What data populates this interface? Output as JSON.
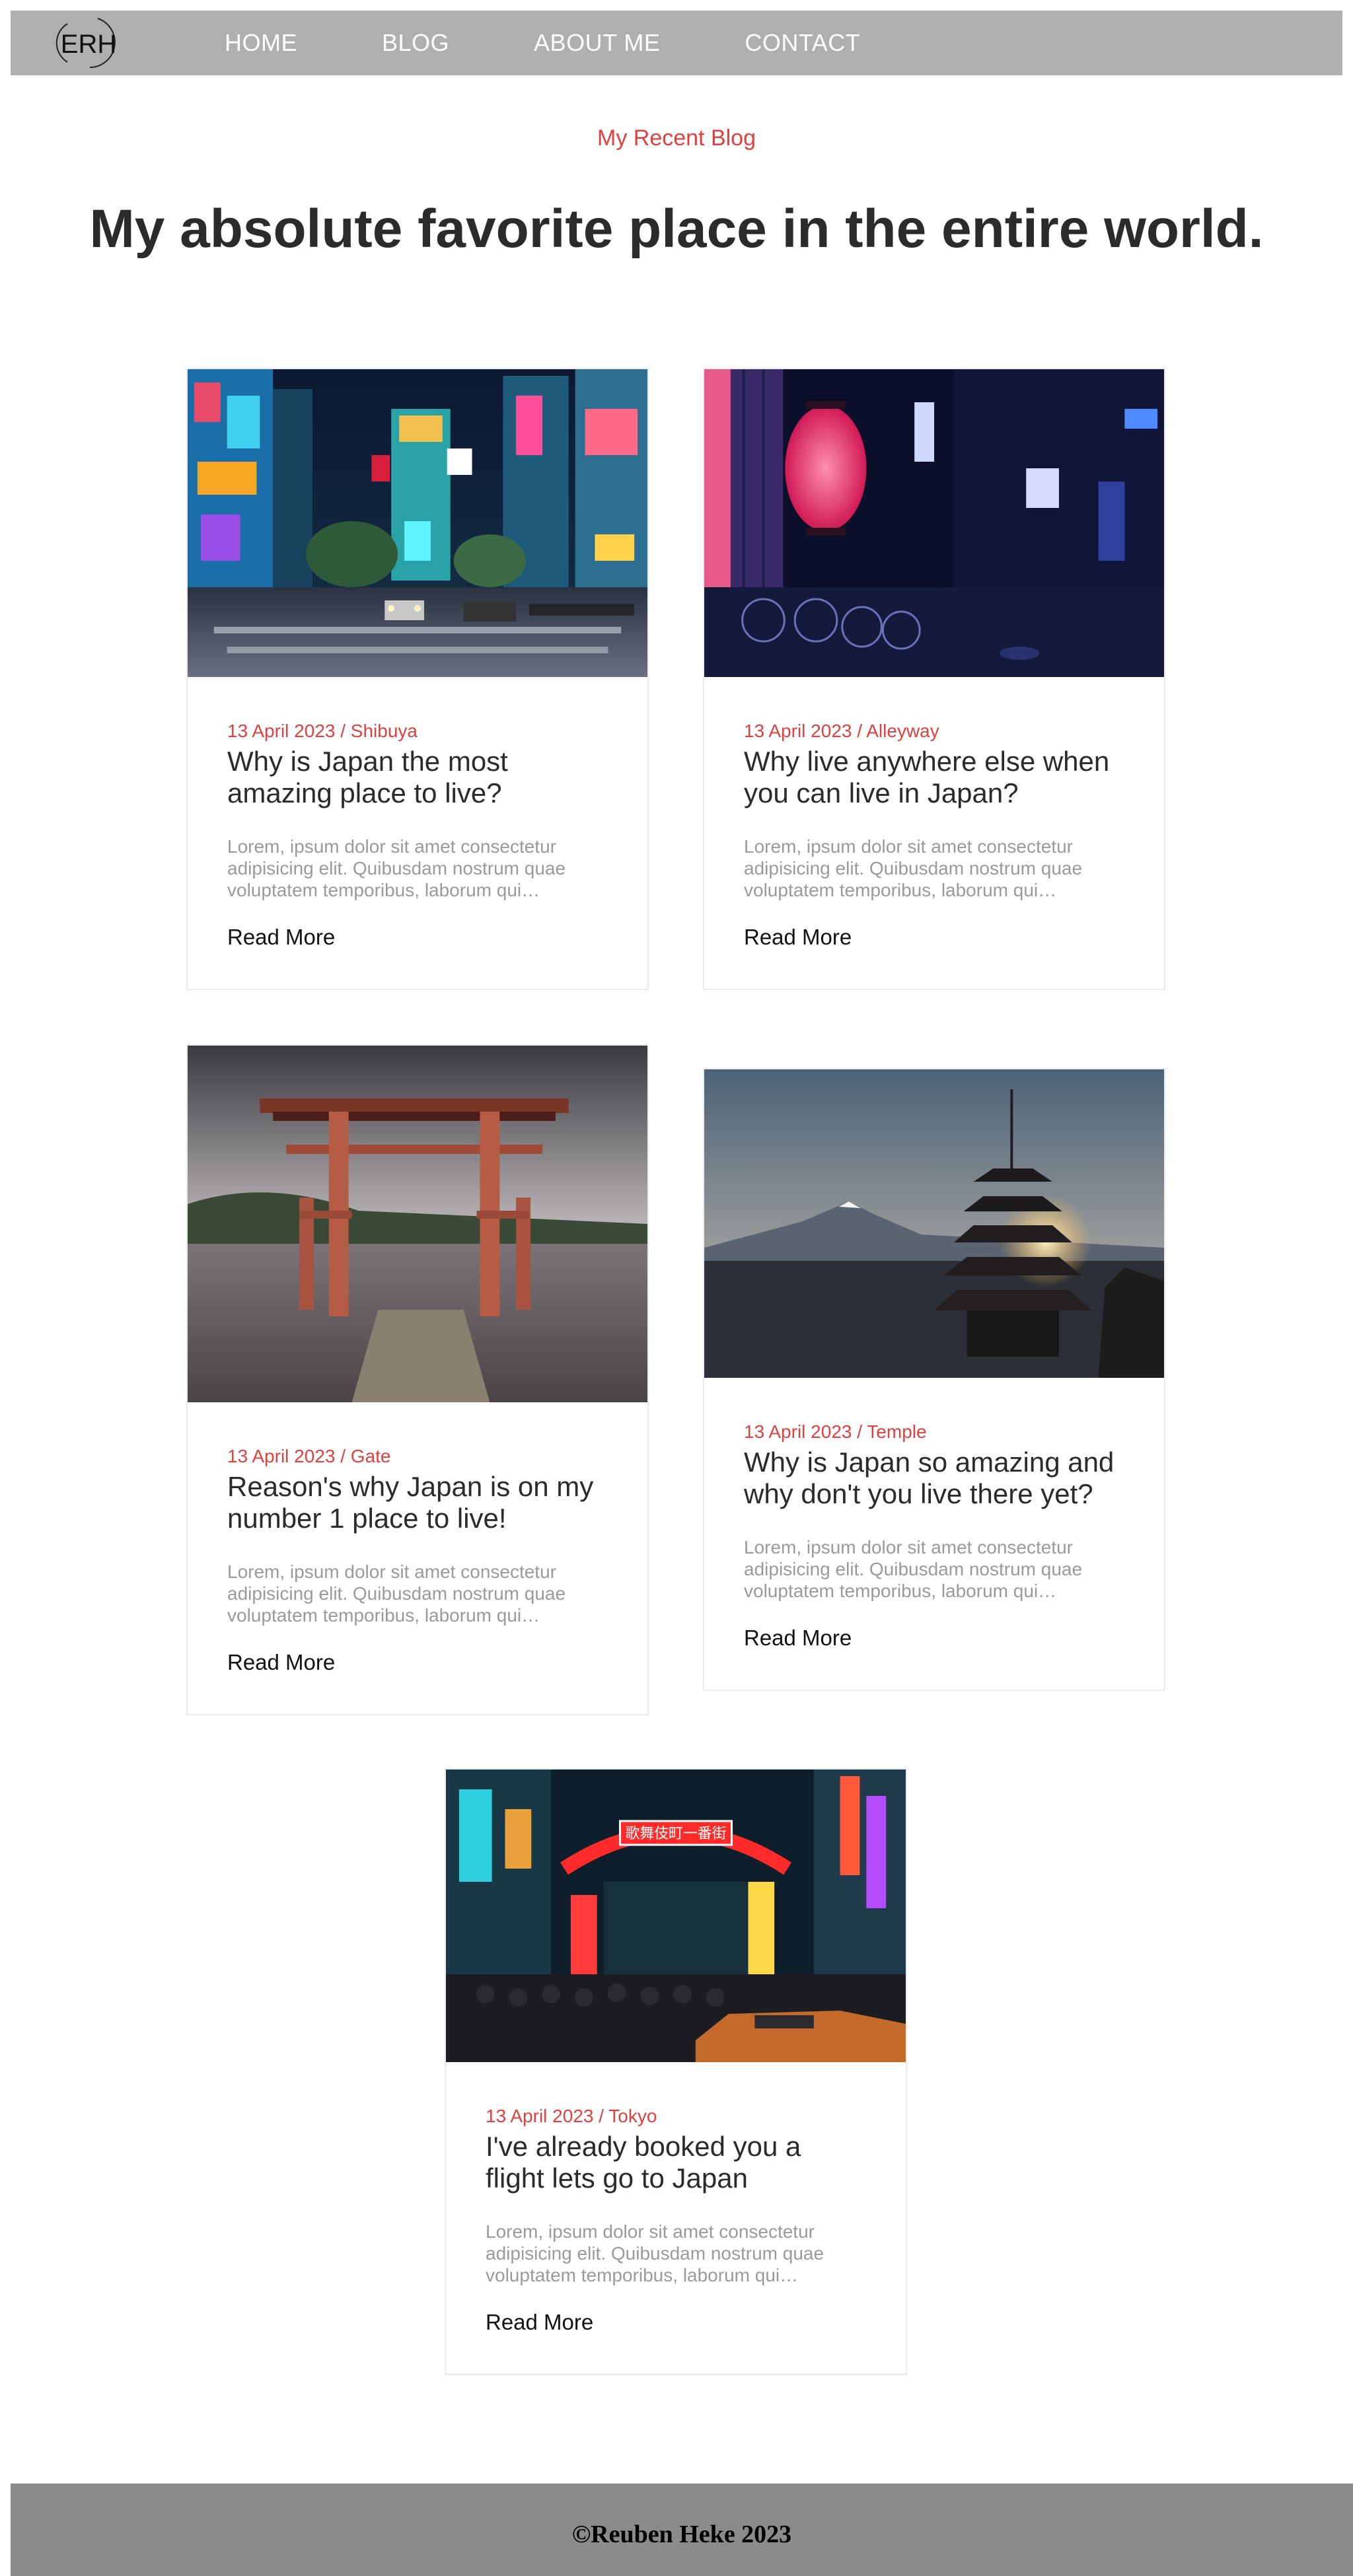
{
  "nav": {
    "logo_text": "ERH",
    "links": [
      {
        "label": "HOME"
      },
      {
        "label": "BLOG"
      },
      {
        "label": "ABOUT ME"
      },
      {
        "label": "CONTACT"
      }
    ]
  },
  "hero": {
    "eyebrow": "My Recent Blog",
    "headline": "My absolute favorite place in the entire world."
  },
  "cards": [
    {
      "meta": "13 April 2023 / Shibuya",
      "title": "Why is Japan the most amazing place to live?",
      "excerpt": "Lorem, ipsum dolor sit amet consectetur adipisicing elit. Quibusdam nostrum quae voluptatem temporibus, laborum qui…",
      "read_more": "Read More",
      "image": "shibuya-crossing-night-photo"
    },
    {
      "meta": "13 April 2023 / Alleyway",
      "title": "Why live anywhere else when you can live in Japan?",
      "excerpt": "Lorem, ipsum dolor sit amet consectetur adipisicing elit. Quibusdam nostrum quae voluptatem temporibus, laborum qui…",
      "read_more": "Read More",
      "image": "lantern-alleyway-night-photo"
    },
    {
      "meta": "13 April 2023 / Gate",
      "title": "Reason's why Japan is on my number 1 place to live!",
      "excerpt": "Lorem, ipsum dolor sit amet consectetur adipisicing elit. Quibusdam nostrum quae voluptatem temporibus, laborum qui…",
      "read_more": "Read More",
      "image": "torii-gate-lake-photo"
    },
    {
      "meta": "13 April 2023 / Temple",
      "title": "Why is Japan so amazing and why don't you live there yet?",
      "excerpt": "Lorem, ipsum dolor sit amet consectetur adipisicing elit. Quibusdam nostrum quae voluptatem temporibus, laborum qui…",
      "read_more": "Read More",
      "image": "pagoda-mount-fuji-sunset-photo"
    },
    {
      "meta": "13 April 2023 / Tokyo",
      "title": "I've already booked you a flight lets go to Japan",
      "excerpt": "Lorem, ipsum dolor sit amet consectetur adipisicing elit. Quibusdam nostrum quae voluptatem temporibus, laborum qui…",
      "read_more": "Read More",
      "image": "kabukicho-gate-tokyo-photo",
      "sign_text": "歌舞伎町一番街"
    }
  ],
  "footer": {
    "text": "©Reuben Heke 2023"
  },
  "colors": {
    "accent": "#e0403e",
    "nav_bg": "#aeb0af",
    "footer_bg": "#8b8b8b",
    "heading": "#2b2b2b",
    "muted": "#9a9a9a"
  }
}
